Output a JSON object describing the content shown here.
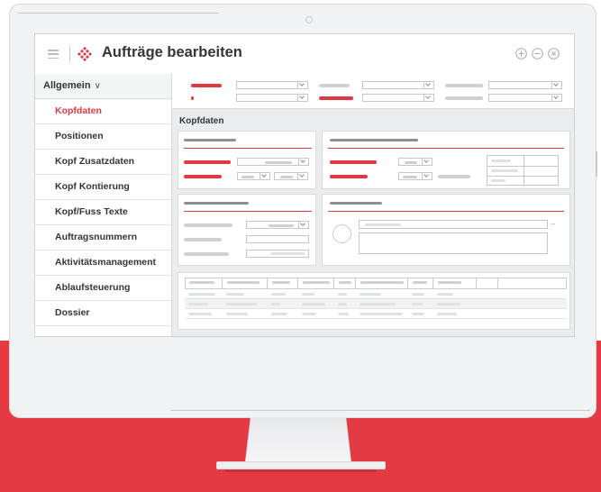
{
  "window": {
    "title": "Aufträge bearbeiten",
    "icons": [
      "menu-icon",
      "diamond-logo-icon",
      "add-circle-icon",
      "minimize-circle-icon",
      "close-circle-icon"
    ]
  },
  "sidebar": {
    "group_label": "Allgemein",
    "group_icon": "chevron-down-icon",
    "items": [
      {
        "label": "Kopfdaten",
        "active": true
      },
      {
        "label": "Positionen",
        "active": false
      },
      {
        "label": "Kopf Zusatzdaten",
        "active": false
      },
      {
        "label": "Kopf Kontierung",
        "active": false
      },
      {
        "label": "Kopf/Fuss Texte",
        "active": false
      },
      {
        "label": "Auftragsnummern",
        "active": false
      },
      {
        "label": "Aktivitätsmanagement",
        "active": false
      },
      {
        "label": "Ablaufsteuerung",
        "active": false
      },
      {
        "label": "Dossier",
        "active": false
      }
    ]
  },
  "main": {
    "section_title": "Kopfdaten",
    "ellipsis": "..."
  },
  "colors": {
    "accent": "#e23a44",
    "background_band": "#e33a44",
    "text": "#333539"
  }
}
